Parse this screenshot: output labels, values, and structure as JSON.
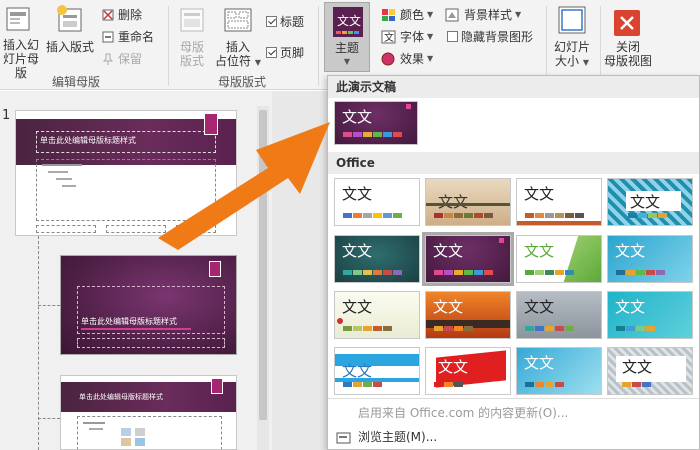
{
  "ribbon": {
    "insert_slide_master_l1": "插入幻",
    "insert_slide_master_l2": "灯片母版",
    "insert_layout_label": "插入版式",
    "delete_label": "删除",
    "rename_label": "重命名",
    "preserve_label": "保留",
    "edit_master_group": "编辑母版",
    "master_layout_l1": "母版",
    "master_layout_l2": "版式",
    "insert_placeholder_l1": "插入",
    "insert_placeholder_l2": "占位符",
    "title_label": "标题",
    "footer_label": "页脚",
    "master_layout_group": "母版版式",
    "themes_label": "主题",
    "colors_label": "颜色",
    "fonts_label": "字体",
    "effects_label": "效果",
    "bg_styles_label": "背景样式",
    "hide_bg_label": "隐藏背景图形",
    "slide_size_l1": "幻灯片",
    "slide_size_l2": "大小",
    "close_master_l1": "关闭",
    "close_master_l2": "母版视图"
  },
  "thumbs": {
    "index": "1",
    "slide1_title": "单击此处编辑母版标题样式",
    "slide2_title": "单击此处编辑母版标题样式",
    "slide3_title": "单击此处编辑母版标题样式"
  },
  "dropdown": {
    "this_presentation": "此演示文稿",
    "office_header": "Office",
    "theme_text": "文文",
    "enable_office_content": "启用来自 Office.com 的内容更新(O)...",
    "browse_themes": "浏览主题(M)..."
  },
  "colors": {
    "accent_orange": "#f07a16",
    "close_red": "#d9432f",
    "purple": "#5a2150"
  }
}
